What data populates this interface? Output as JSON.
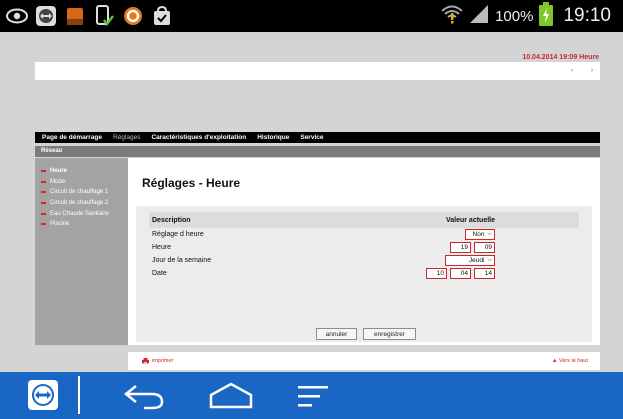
{
  "status_bar": {
    "battery_percent": "100%",
    "time": "19:10",
    "icons": [
      "eye-icon",
      "teamviewer-icon",
      "app-orange-icon",
      "phone-check-icon",
      "avast-icon",
      "bag-check-icon",
      "wifi-warning-icon",
      "signal-icon",
      "battery-charging-icon"
    ]
  },
  "header": {
    "datetime": "10.04.2014  19:09 Heure",
    "arrows": [
      "›",
      "›"
    ]
  },
  "nav": {
    "items": [
      "Page de démarrage",
      "Réglages",
      "Caractéristiques d'exploitation",
      "Historique",
      "Service"
    ],
    "active": "Réglages"
  },
  "breadcrumb": "Réseau",
  "sidebar": {
    "items": [
      "Heure",
      "Mode",
      "Circuit de chauffage 1",
      "Circuit de chauffage 2",
      "Eau Chaude Sanitaire",
      "Piscine"
    ],
    "active": "Heure"
  },
  "main": {
    "title": "Réglages - Heure",
    "table": {
      "col_description": "Description",
      "col_value": "Valeur actuelle",
      "rows": [
        {
          "label": "Réglage d heure",
          "value": "Non"
        },
        {
          "label": "Heure",
          "hours": "19",
          "minutes": "09"
        },
        {
          "label": "Jour de la semaine",
          "value": "Jeudi"
        },
        {
          "label": "Date",
          "day": "10",
          "month": "04",
          "year": "14"
        }
      ]
    },
    "buttons": {
      "cancel": "annuler",
      "save": "enregistrer"
    }
  },
  "footer": {
    "print": "imprimer",
    "top": "Vers le haut"
  },
  "colors": {
    "accent": "#c8282a",
    "navbar": "#1a66c4"
  }
}
